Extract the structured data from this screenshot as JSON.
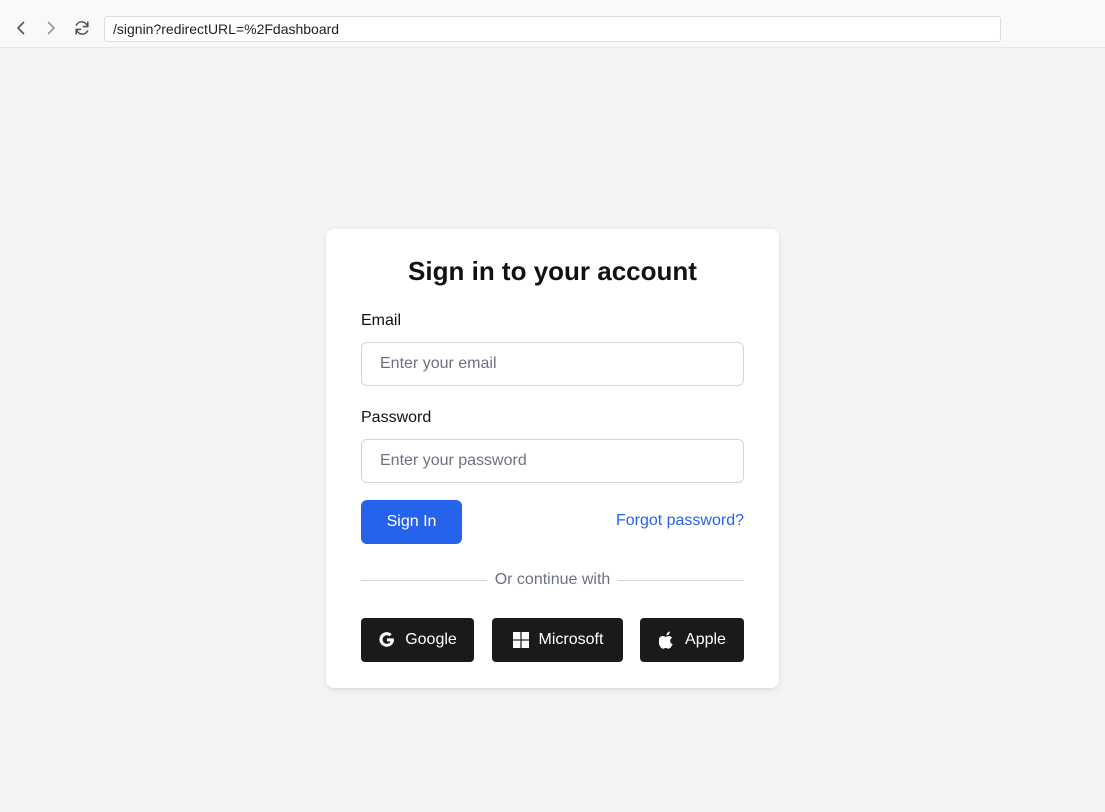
{
  "browser": {
    "url": "/signin?redirectURL=%2Fdashboard"
  },
  "form": {
    "title": "Sign in to your account",
    "email_label": "Email",
    "email_placeholder": "Enter your email",
    "email_value": "",
    "password_label": "Password",
    "password_placeholder": "Enter your password",
    "password_value": "",
    "signin_label": "Sign In",
    "forgot_label": "Forgot password?",
    "divider_text": "Or continue with"
  },
  "social": {
    "google_label": "Google",
    "microsoft_label": "Microsoft",
    "apple_label": "Apple"
  },
  "icons": {
    "back": "chevron-left-icon",
    "forward": "chevron-right-icon",
    "reload": "reload-icon",
    "google": "google-icon",
    "microsoft": "microsoft-icon",
    "apple": "apple-icon"
  },
  "colors": {
    "page_background": "#f3f4f6",
    "primary": "#2563eb",
    "social_button": "#1a1a1a",
    "card": "#ffffff"
  }
}
